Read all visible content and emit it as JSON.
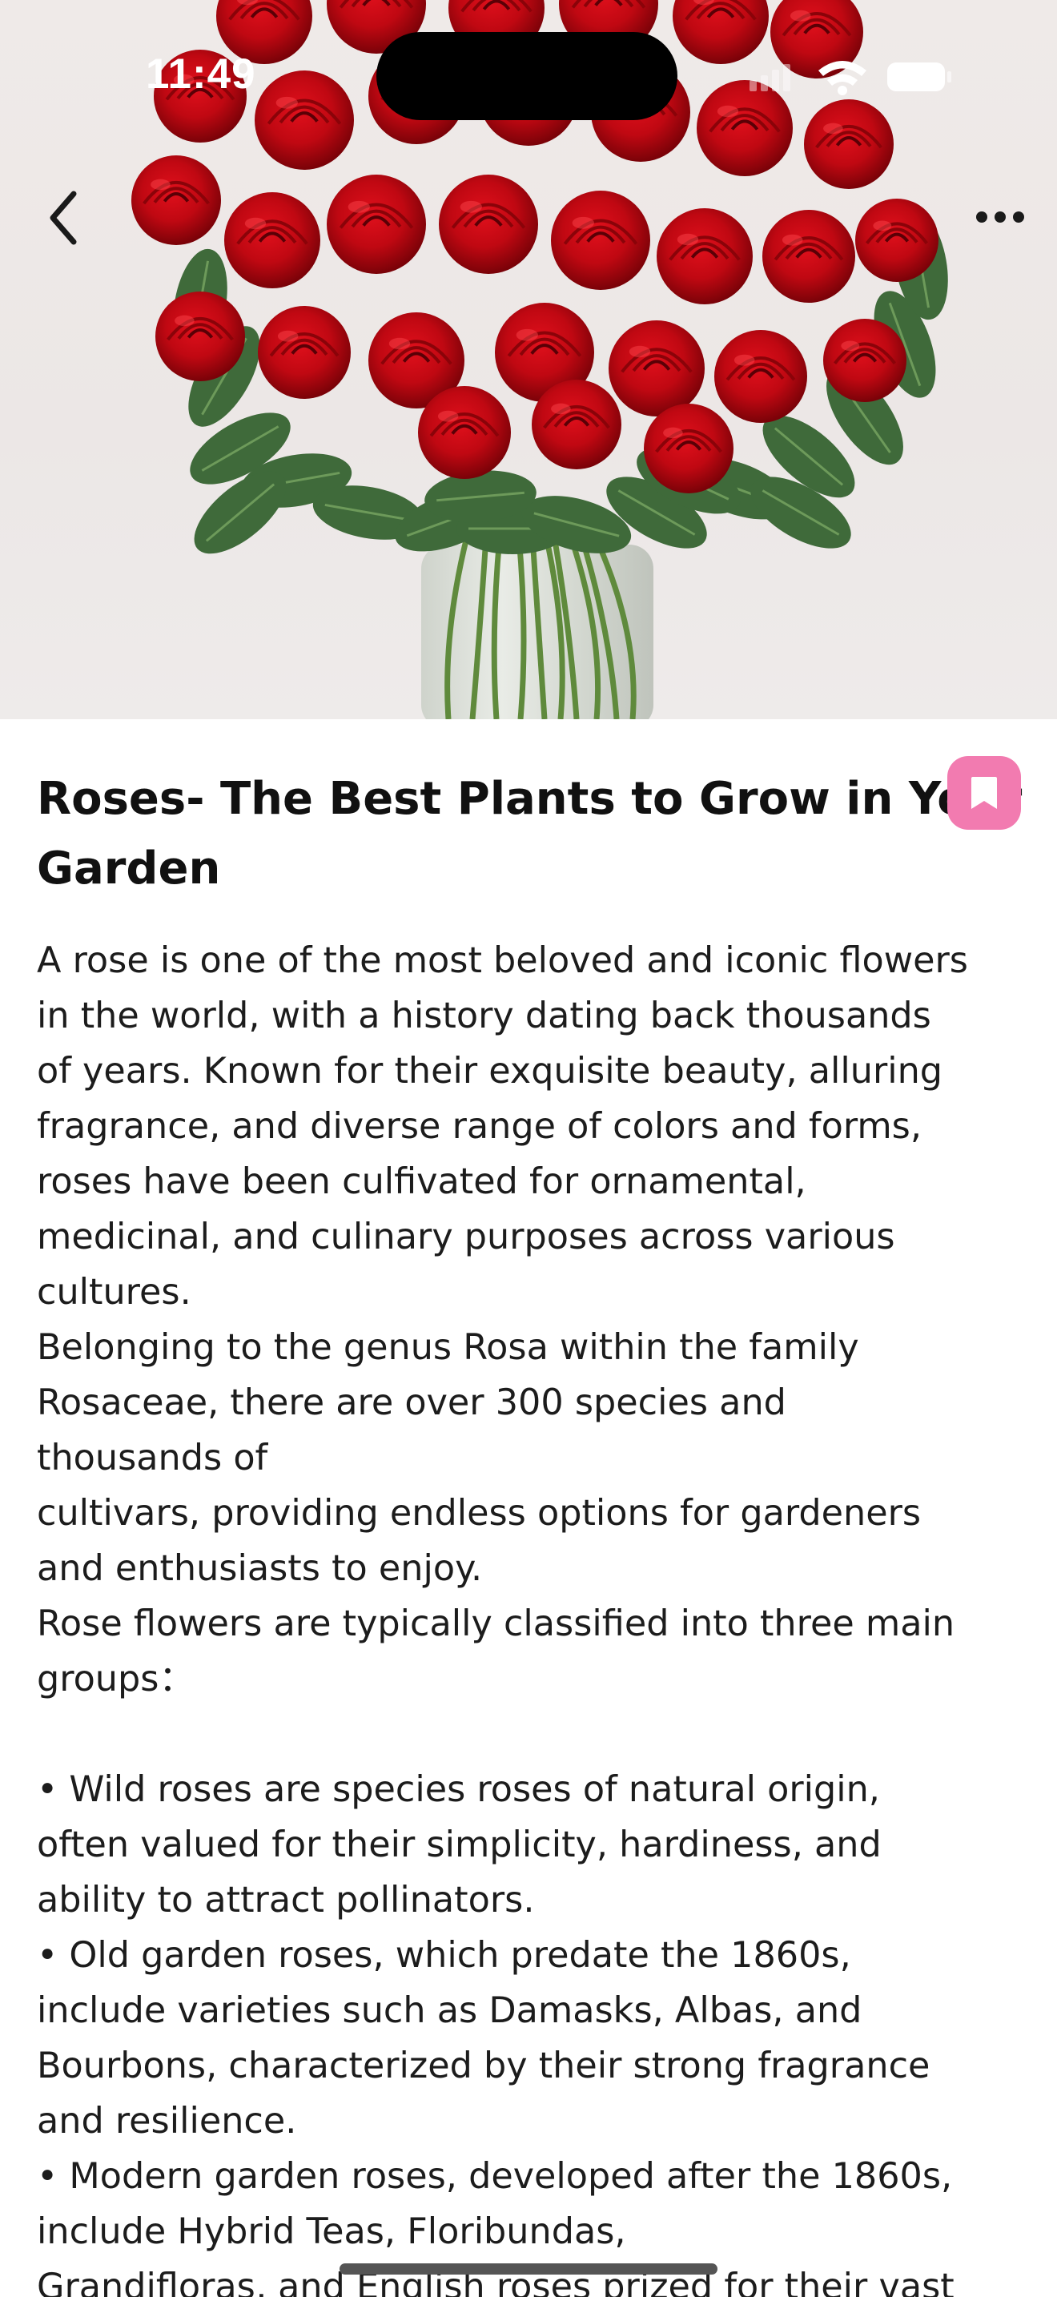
{
  "status_bar": {
    "time": "11:49"
  },
  "nav": {
    "back_icon": "chevron-left-icon",
    "more_icon": "ellipsis-icon"
  },
  "hero": {
    "image_icon": "red-roses-bouquet-photo"
  },
  "article": {
    "title_lines": [
      "Roses- The Best Plants to Grow in Your",
      "Garden"
    ],
    "bookmark_icon": "bookmark-icon",
    "accent_color": "#f27bb0",
    "body_lines": [
      "A rose is one of the most beloved and iconic flowers",
      "in the world, with a history dating back thousands",
      "of years. Known for their exquisite beauty, alluring",
      "fragrance, and diverse range of colors and forms,",
      "roses have been culfivated for ornamental,",
      "medicinal, and culinary purposes across various",
      "cultures.",
      "Belonging to the genus Rosa within the family",
      "Rosaceae, there are over 300 species and",
      "thousands of",
      "cultivars, providing endless options for gardeners",
      "and enthusiasts to enjoy.",
      "Rose flowers are typically classified into three main",
      "groups：",
      "",
      "• Wild roses are species roses of natural origin,",
      "often valued for their simplicity, hardiness, and",
      "ability to attract pollinators.",
      "• Old garden roses, which predate the 1860s,",
      "include varieties such as Damasks, Albas, and",
      "Bourbons, characterized by their strong fragrance",
      "and resilience.",
      "• Modern garden roses, developed after the 1860s,",
      "include Hybrid Teas, Floribundas,",
      "Grandifloras, and English roses prized for their vast"
    ]
  }
}
